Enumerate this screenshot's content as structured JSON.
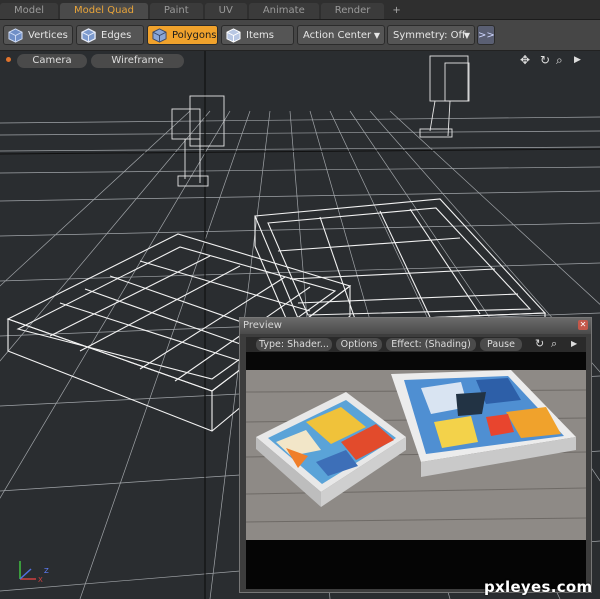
{
  "tabs": [
    "Model",
    "Model Quad",
    "Paint",
    "UV",
    "Animate",
    "Render"
  ],
  "active_tab_index": 1,
  "tab_add_label": "+",
  "toolbar": {
    "vertices": "Vertices",
    "edges": "Edges",
    "polygons": "Polygons",
    "items": "Items",
    "action_center": "Action Center",
    "symmetry": "Symmetry: Off",
    "more": ">>"
  },
  "viewport": {
    "camera": "Camera",
    "wireframe": "Wireframe"
  },
  "preview": {
    "title": "Preview",
    "type": "Type: Shader...",
    "options": "Options",
    "effect": "Effect: (Shading)",
    "pause": "Pause"
  },
  "watermark": "pxleyes.com",
  "colors": {
    "accent": "#f0a22c",
    "toolbar": "#464646",
    "viewport": "#2a2d30"
  }
}
